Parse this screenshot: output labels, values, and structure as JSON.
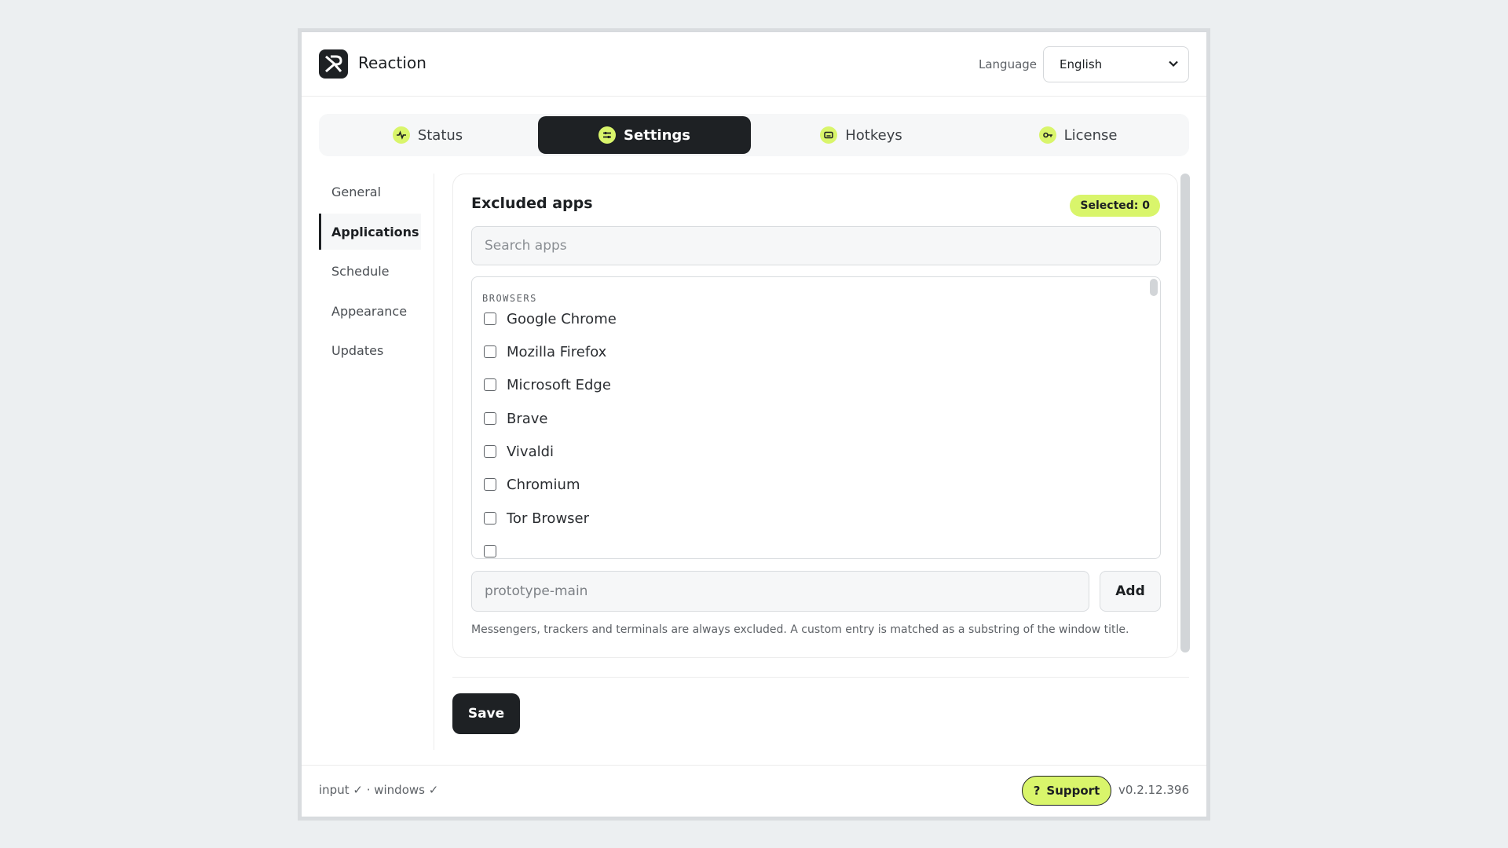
{
  "header": {
    "app_title": "Reaction",
    "language_label": "Language",
    "language_value": "English"
  },
  "tabs": [
    {
      "label": "Status",
      "icon": "activity-icon"
    },
    {
      "label": "Settings",
      "icon": "sliders-icon"
    },
    {
      "label": "Hotkeys",
      "icon": "keyboard-icon"
    },
    {
      "label": "License",
      "icon": "key-icon"
    }
  ],
  "active_tab": "Settings",
  "sidebar": {
    "items": [
      {
        "label": "General"
      },
      {
        "label": "Applications"
      },
      {
        "label": "Schedule"
      },
      {
        "label": "Appearance"
      },
      {
        "label": "Updates"
      }
    ],
    "active": "Applications"
  },
  "card": {
    "title": "Excluded apps",
    "selected_badge": "Selected: 0",
    "search_placeholder": "Search apps",
    "group_label": "BROWSERS",
    "apps": [
      {
        "label": "Google Chrome",
        "checked": false
      },
      {
        "label": "Mozilla Firefox",
        "checked": false
      },
      {
        "label": "Microsoft Edge",
        "checked": false
      },
      {
        "label": "Brave",
        "checked": false
      },
      {
        "label": "Vivaldi",
        "checked": false
      },
      {
        "label": "Chromium",
        "checked": false
      },
      {
        "label": "Tor Browser",
        "checked": false
      }
    ],
    "custom_placeholder": "prototype-main",
    "add_label": "Add",
    "hint": "Messengers, trackers and terminals are always excluded. A custom entry is matched as a substring of the window title."
  },
  "save_label": "Save",
  "footer": {
    "status": "input ✓ · windows ✓",
    "support_label": "Support",
    "support_icon": "?",
    "version": "v0.2.12.396"
  },
  "colors": {
    "accent": "#d9f56b",
    "dark": "#1e2124",
    "background": "#eceff1"
  }
}
